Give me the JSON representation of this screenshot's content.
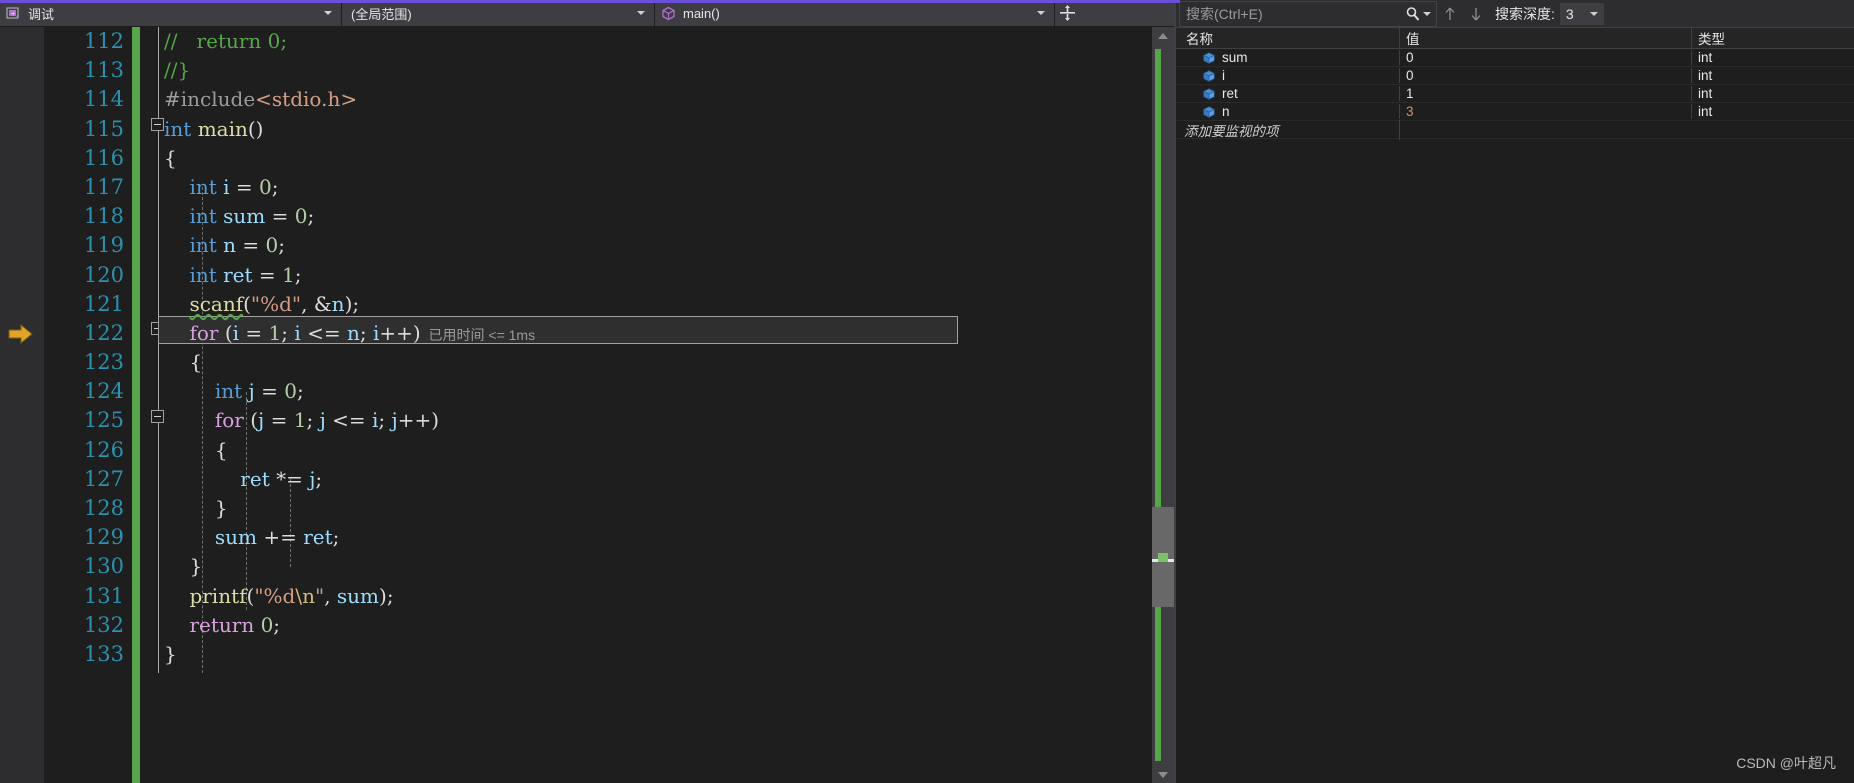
{
  "navbar": {
    "process_label": "调试",
    "process_icon": "debug-process-icon",
    "scope_label": "(全局范围)",
    "function_label": "main()",
    "function_icon": "method-cube-icon",
    "split_icon": "split-window-icon"
  },
  "watch": {
    "search_placeholder": "搜索(Ctrl+E)",
    "search_icon": "magnifier-icon",
    "up_icon": "arrow-up-icon",
    "down_icon": "arrow-down-icon",
    "depth_label": "搜索深度:",
    "depth_value": "3",
    "columns": [
      "名称",
      "值",
      "类型"
    ],
    "rows": [
      {
        "icon": "variable-cube-icon",
        "name": "sum",
        "value": "0",
        "type": "int",
        "changed": false
      },
      {
        "icon": "variable-cube-icon",
        "name": "i",
        "value": "0",
        "type": "int",
        "changed": false
      },
      {
        "icon": "variable-cube-icon",
        "name": "ret",
        "value": "1",
        "type": "int",
        "changed": false
      },
      {
        "icon": "variable-cube-icon",
        "name": "n",
        "value": "3",
        "type": "int",
        "changed": true
      }
    ],
    "add_watch_text": "添加要监视的项"
  },
  "editor": {
    "first_line_number": 112,
    "current_line": 122,
    "time_hint": "已用时间 <= 1ms",
    "exec_arrow_icon": "execution-pointer-icon",
    "lines": [
      {
        "n": "112",
        "text": "//   return 0;"
      },
      {
        "n": "113",
        "text": "//}"
      },
      {
        "n": "114",
        "text": "#include<stdio.h>"
      },
      {
        "n": "115",
        "text": "int main()"
      },
      {
        "n": "116",
        "text": "{"
      },
      {
        "n": "117",
        "text": "    int i = 0;"
      },
      {
        "n": "118",
        "text": "    int sum = 0;"
      },
      {
        "n": "119",
        "text": "    int n = 0;"
      },
      {
        "n": "120",
        "text": "    int ret = 1;"
      },
      {
        "n": "121",
        "text": "    scanf(\"%d\", &n);"
      },
      {
        "n": "122",
        "text": "    for (i = 1; i <= n; i++)"
      },
      {
        "n": "123",
        "text": "    {"
      },
      {
        "n": "124",
        "text": "        int j = 0;"
      },
      {
        "n": "125",
        "text": "        for (j = 1; j <= i; j++)"
      },
      {
        "n": "126",
        "text": "        {"
      },
      {
        "n": "127",
        "text": "            ret *= j;"
      },
      {
        "n": "128",
        "text": "        }"
      },
      {
        "n": "129",
        "text": "        sum += ret;"
      },
      {
        "n": "130",
        "text": "    }"
      },
      {
        "n": "131",
        "text": "    printf(\"%d\\n\", sum);"
      },
      {
        "n": "132",
        "text": "    return 0;"
      },
      {
        "n": "133",
        "text": "}"
      }
    ]
  },
  "watermark": "CSDN @叶超凡",
  "colors": {
    "accent": "#6b4fd8",
    "editor_bg": "#1e1e1e",
    "gutter_bg": "#2d2d30",
    "linenum": "#2b91af",
    "change_bar": "#57a64a",
    "keyword": "#569cd6",
    "control": "#d8a0df",
    "string": "#d69d85",
    "comment": "#57a64a",
    "function": "#dcdcaa",
    "identifier": "#9cdcfe",
    "changed_value": "#d98c7a",
    "exec_arrow": "#e0a526"
  }
}
